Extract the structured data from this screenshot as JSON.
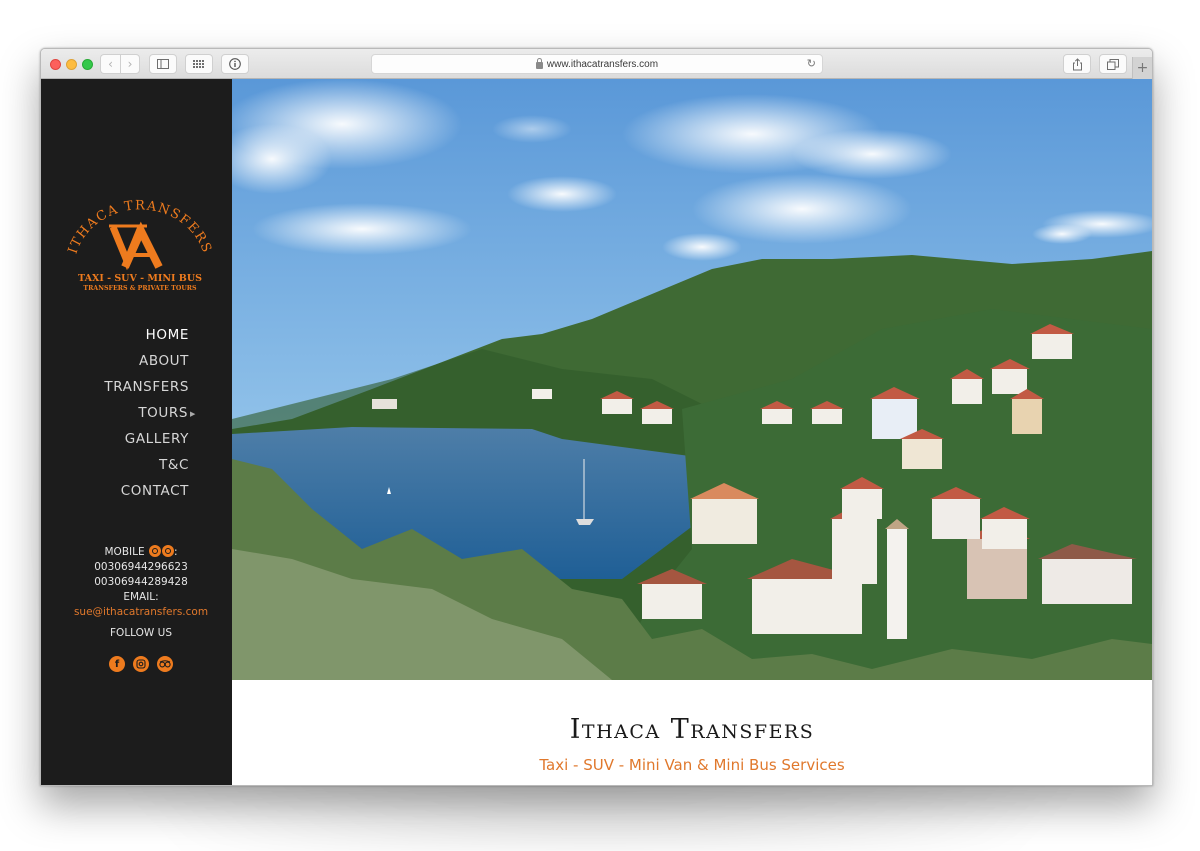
{
  "browser": {
    "url": "www.ithacatransfers.com",
    "new_tab_label": "+",
    "icons": {
      "back": "chevron-left",
      "forward": "chevron-right",
      "sidebar": "sidebar-toggle",
      "grid": "top-sites-grid",
      "info": "info-circle",
      "lock": "lock",
      "reload": "reload",
      "share": "share",
      "tabs": "tab-overview"
    }
  },
  "sidebar": {
    "logo": {
      "arc_text": "ITHACA TRANSFERS",
      "monogram": "A",
      "line1": "TAXI - SUV - MINI BUS",
      "line2": "TRANSFERS & PRIVATE TOURS"
    },
    "nav": [
      {
        "label": "HOME",
        "active": true
      },
      {
        "label": "ABOUT"
      },
      {
        "label": "TRANSFERS"
      },
      {
        "label": "TOURS",
        "submenu": true
      },
      {
        "label": "GALLERY"
      },
      {
        "label": "T&C"
      },
      {
        "label": "CONTACT"
      }
    ],
    "contact": {
      "mobile_label": "MOBILE",
      "mobile_colon": ":",
      "phone1": "00306944296623",
      "phone2": "00306944289428",
      "email_label": "EMAIL:",
      "email": "sue@ithacatransfers.com",
      "follow_label": "FOLLOW US",
      "social": [
        {
          "name": "facebook",
          "glyph": "f"
        },
        {
          "name": "instagram",
          "glyph": "◎"
        },
        {
          "name": "tripadvisor",
          "glyph": "∞"
        }
      ]
    }
  },
  "hero": {
    "image_alt": "Panoramic view of Kioni harbour in Ithaca with blue bay, sailboats, green hills and red-roofed village houses"
  },
  "main": {
    "title": "Ithaca Transfers",
    "subtitle": "Taxi - SUV - Mini Van & Mini Bus Services"
  },
  "colors": {
    "accent": "#e0782c",
    "sidebar_bg": "#1c1c1c",
    "nav_text": "#d6d6d6"
  }
}
